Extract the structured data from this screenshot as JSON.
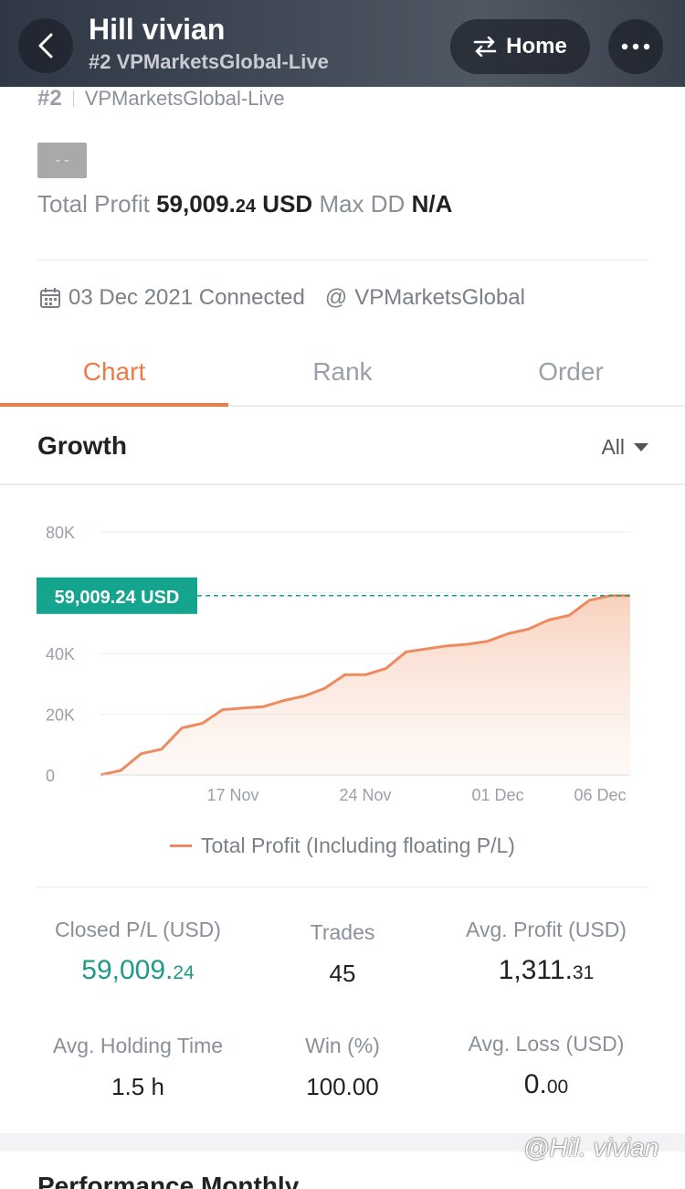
{
  "header": {
    "title": "Hill vivian",
    "subtitle": "#2 VPMarketsGlobal-Live",
    "home_label": "Home"
  },
  "account": {
    "rank": "#2",
    "server": "VPMarketsGlobal-Live",
    "badge": "- -",
    "total_profit_label": "Total Profit",
    "total_profit_int": "59,009.",
    "total_profit_dec": "24",
    "total_profit_unit": "USD",
    "max_dd_label": "Max DD",
    "max_dd_value": "N/A",
    "connected_text": "03 Dec 2021 Connected",
    "broker": "VPMarketsGlobal"
  },
  "tabs": [
    {
      "label": "Chart",
      "active": true
    },
    {
      "label": "Rank",
      "active": false
    },
    {
      "label": "Order",
      "active": false
    }
  ],
  "growth": {
    "title": "Growth",
    "filter": "All"
  },
  "chart_data": {
    "type": "area",
    "title": "",
    "y_ticks": [
      "0",
      "20K",
      "40K",
      "80K"
    ],
    "x_ticks": [
      "17 Nov",
      "24 Nov",
      "01 Dec",
      "06 Dec"
    ],
    "ylim": [
      0,
      80000
    ],
    "grid": true,
    "current_value_label": "59,009.24 USD",
    "current_value": 59009.24,
    "series": [
      {
        "name": "Total Profit (Including floating P/L)",
        "values": [
          0,
          1500,
          7000,
          8500,
          15500,
          17000,
          21500,
          22000,
          22500,
          24500,
          26000,
          28500,
          33000,
          33000,
          35000,
          40500,
          41500,
          42500,
          43000,
          44000,
          46500,
          48000,
          51000,
          52500,
          57500,
          59009.24,
          59009.24
        ]
      }
    ],
    "colors": {
      "line": "#ee8a5f",
      "fill": "#fbe2d6",
      "marker": "#15a58f"
    }
  },
  "stats": {
    "closed_pl_label": "Closed P/L (USD)",
    "closed_pl_int": "59,009.",
    "closed_pl_dec": "24",
    "trades_label": "Trades",
    "trades_value": "45",
    "avg_profit_label": "Avg. Profit (USD)",
    "avg_profit_int": "1,311.",
    "avg_profit_dec": "31",
    "avg_hold_label": "Avg. Holding Time",
    "avg_hold_value": "1.5 h",
    "win_label": "Win (%)",
    "win_value": "100.00",
    "avg_loss_label": "Avg. Loss (USD)",
    "avg_loss_int": "0.",
    "avg_loss_dec": "00"
  },
  "performance": {
    "title": "Performance Monthly"
  },
  "watermark": "@Hil. vivian",
  "colors": {
    "accent": "#ee7b45",
    "profit_green": "#1e9a89",
    "marker_green": "#15a58f"
  }
}
